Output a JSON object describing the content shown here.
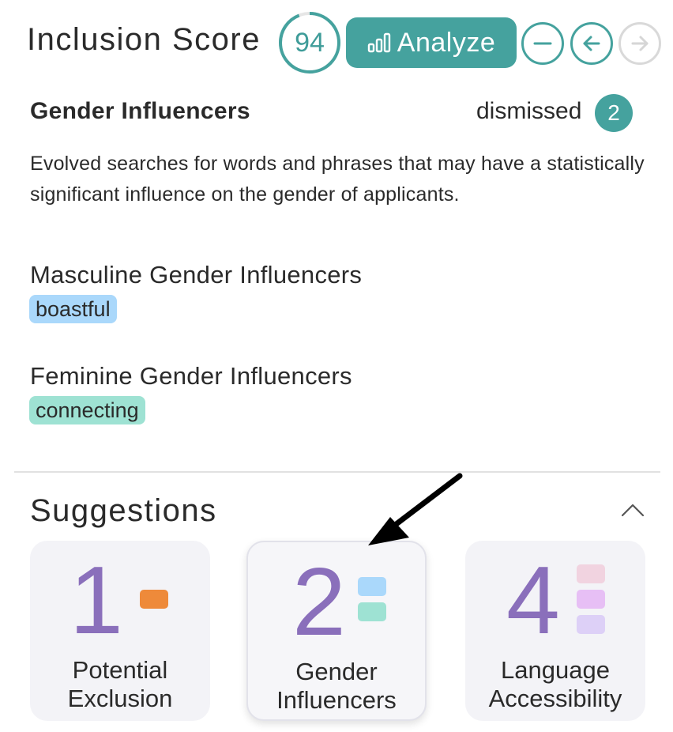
{
  "header": {
    "title": "Inclusion Score",
    "score": "94",
    "analyze_label": "Analyze"
  },
  "section": {
    "title": "Gender Influencers",
    "dismissed_label": "dismissed",
    "dismissed_count": "2",
    "description": "Evolved searches for words and phrases that may have a statistically significant influence on the gender of applicants."
  },
  "groups": [
    {
      "label": "Masculine Gender Influencers",
      "chip": "boastful",
      "color": "#aad8fb"
    },
    {
      "label": "Feminine Gender Influencers",
      "chip": "connecting",
      "color": "#9ee2d3"
    }
  ],
  "suggestions": {
    "title": "Suggestions",
    "cards": [
      {
        "count": "1",
        "label_line1": "Potential",
        "label_line2": "Exclusion",
        "swatches": [
          "#ee8a3a"
        ]
      },
      {
        "count": "2",
        "label_line1": "Gender",
        "label_line2": "Influencers",
        "swatches": [
          "#aad8fb",
          "#9ee2d3"
        ]
      },
      {
        "count": "4",
        "label_line1": "Language",
        "label_line2": "Accessibility",
        "swatches": [
          "#f1d3e0",
          "#e7bff5",
          "#ddd0f7"
        ]
      }
    ]
  },
  "colors": {
    "accent": "#45a29e",
    "number_purple": "#8a6fbb"
  },
  "icons": [
    "bar-chart-icon",
    "minus-icon",
    "arrow-left-icon",
    "arrow-right-icon",
    "chevron-up-icon"
  ]
}
